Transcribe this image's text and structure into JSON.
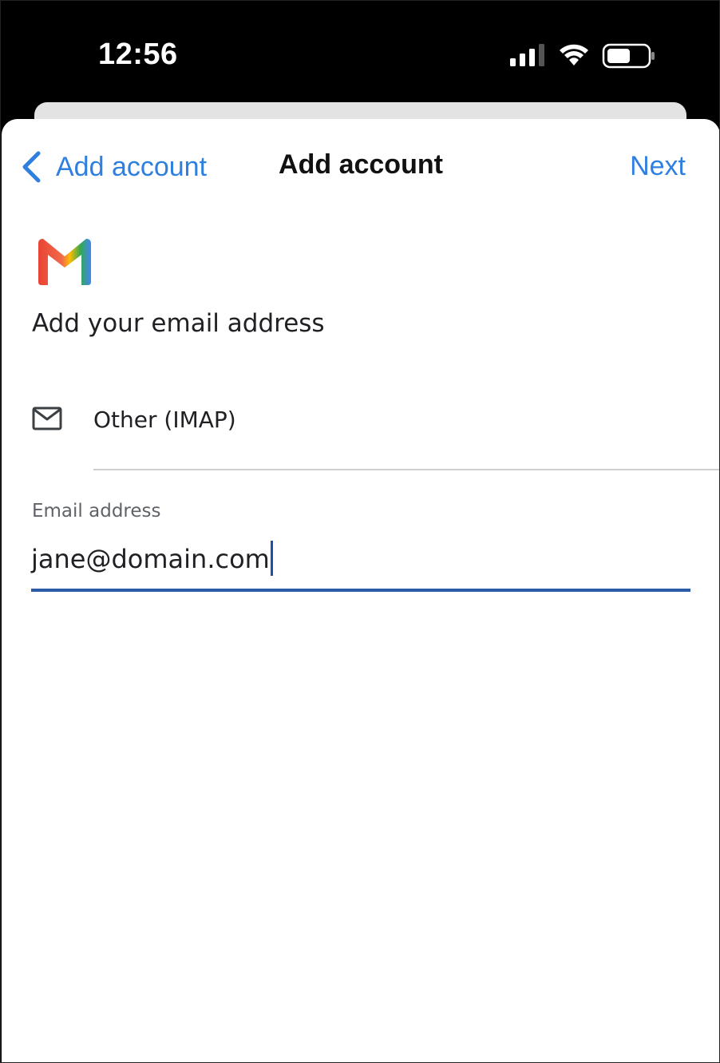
{
  "status_bar": {
    "time": "12:56",
    "icons": [
      "cellular-signal-icon",
      "wifi-icon",
      "battery-icon"
    ]
  },
  "nav": {
    "back_label": "Add account",
    "title": "Add account",
    "next_label": "Next",
    "accent_color": "#2f7fe0"
  },
  "main": {
    "logo": "gmail-logo",
    "heading": "Add your email address",
    "option": {
      "icon": "mail-icon",
      "label": "Other (IMAP)"
    },
    "email_field": {
      "label": "Email address",
      "value": "jane@domain.com",
      "underline_color": "#2b5aa8"
    }
  }
}
